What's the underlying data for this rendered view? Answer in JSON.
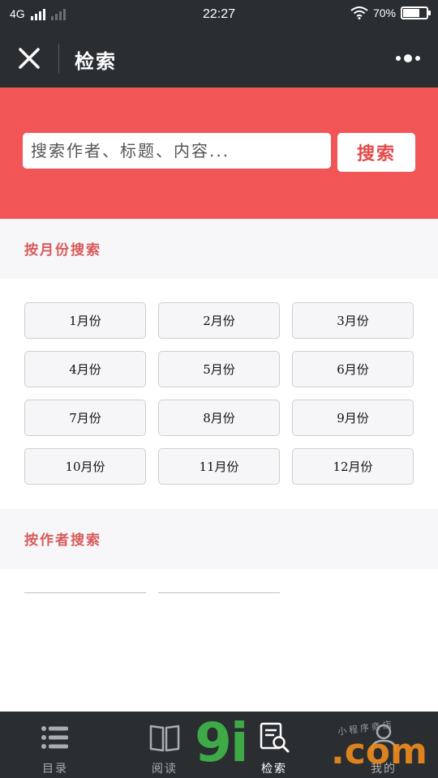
{
  "status_bar": {
    "network": "4G",
    "time": "22:27",
    "battery_percent": "70%",
    "battery_level": 0.7
  },
  "nav": {
    "title": "检索"
  },
  "search": {
    "placeholder": "搜索作者、标题、内容...",
    "button_label": "搜索"
  },
  "sections": {
    "by_month": "按月份搜索",
    "by_author": "按作者搜索"
  },
  "months": [
    "1月份",
    "2月份",
    "3月份",
    "4月份",
    "5月份",
    "6月份",
    "7月份",
    "8月份",
    "9月份",
    "10月份",
    "11月份",
    "12月份"
  ],
  "tabs": [
    {
      "label": "目录",
      "icon": "list-icon",
      "active": false
    },
    {
      "label": "阅读",
      "icon": "book-icon",
      "active": false
    },
    {
      "label": "检索",
      "icon": "search-doc-icon",
      "active": true
    },
    {
      "label": "我的",
      "icon": "user-icon",
      "active": false
    }
  ],
  "watermark": {
    "brand": "9i",
    "domain": ".com",
    "tagline": "小程序商店"
  },
  "colors": {
    "header_red": "#f25555",
    "dark_bar": "#2b2e31",
    "section_title": "#d85a5a",
    "watermark_green": "#3fb84a",
    "watermark_orange": "#f08c1c"
  }
}
